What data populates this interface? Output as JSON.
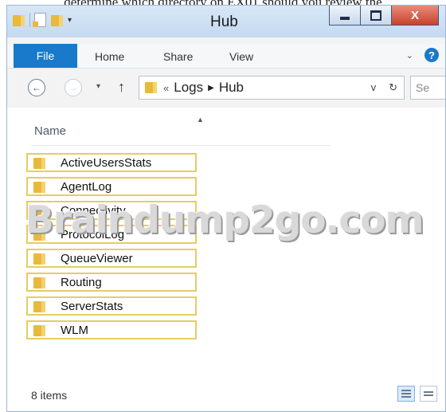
{
  "top_text": "determine which directory on EX01 should you review the",
  "window": {
    "title": "Hub",
    "buttons": {
      "minimize": "minimize",
      "maximize": "maximize",
      "close": "X"
    }
  },
  "ribbon": {
    "tabs": [
      "File",
      "Home",
      "Share",
      "View"
    ],
    "expand_icon": "chevron-down-icon",
    "help_label": "?"
  },
  "nav": {
    "back": "←",
    "forward": "→",
    "recent": "▾",
    "up": "↑",
    "breadcrumb_lead": "«",
    "breadcrumb": [
      "Logs",
      "Hub"
    ],
    "dropdown": "v",
    "refresh": "↻",
    "search_placeholder": "Se"
  },
  "list": {
    "column_header": "Name",
    "items": [
      "ActiveUsersStats",
      "AgentLog",
      "Connectivity",
      "ProtocolLog",
      "QueueViewer",
      "Routing",
      "ServerStats",
      "WLM"
    ]
  },
  "watermark": "Braindump2go.com",
  "status": {
    "item_count": "8 items"
  },
  "colors": {
    "file_tab": "#1979ca",
    "folder": "#e8b93a",
    "highlight": "#e6cc64"
  }
}
